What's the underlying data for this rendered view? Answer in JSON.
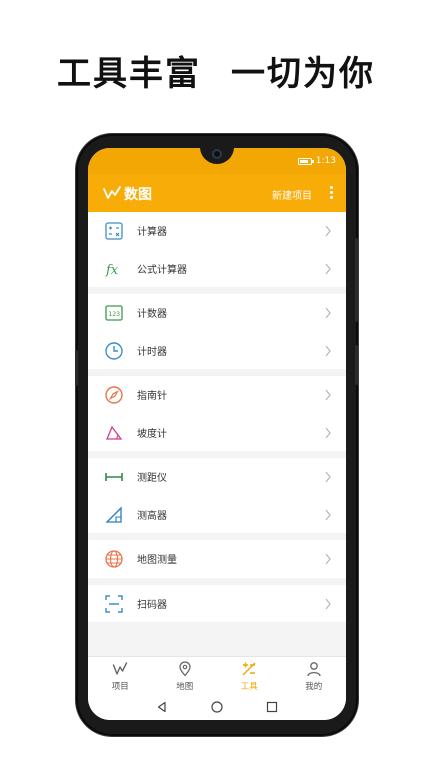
{
  "headline": {
    "left": "工具丰富",
    "right": "一切为你"
  },
  "status": {
    "time": "1:13"
  },
  "appbar": {
    "title": "数图",
    "new_project": "新建项目"
  },
  "groups": [
    [
      {
        "label": "计算器",
        "icon": "calculator-icon"
      },
      {
        "label": "公式计算器",
        "icon": "formula-icon"
      }
    ],
    [
      {
        "label": "计数器",
        "icon": "counter-icon"
      },
      {
        "label": "计时器",
        "icon": "clock-icon"
      }
    ],
    [
      {
        "label": "指南针",
        "icon": "compass-icon"
      },
      {
        "label": "坡度计",
        "icon": "slope-icon"
      }
    ],
    [
      {
        "label": "测距仪",
        "icon": "ruler-icon"
      },
      {
        "label": "测高器",
        "icon": "height-icon"
      }
    ],
    [
      {
        "label": "地图测量",
        "icon": "globe-icon"
      }
    ],
    [
      {
        "label": "扫码器",
        "icon": "scan-icon"
      }
    ]
  ],
  "nav": {
    "projects": "项目",
    "map": "地图",
    "tools": "工具",
    "mine": "我的"
  },
  "colors": {
    "accent": "#f3a705",
    "bar": "#f7ac08"
  }
}
